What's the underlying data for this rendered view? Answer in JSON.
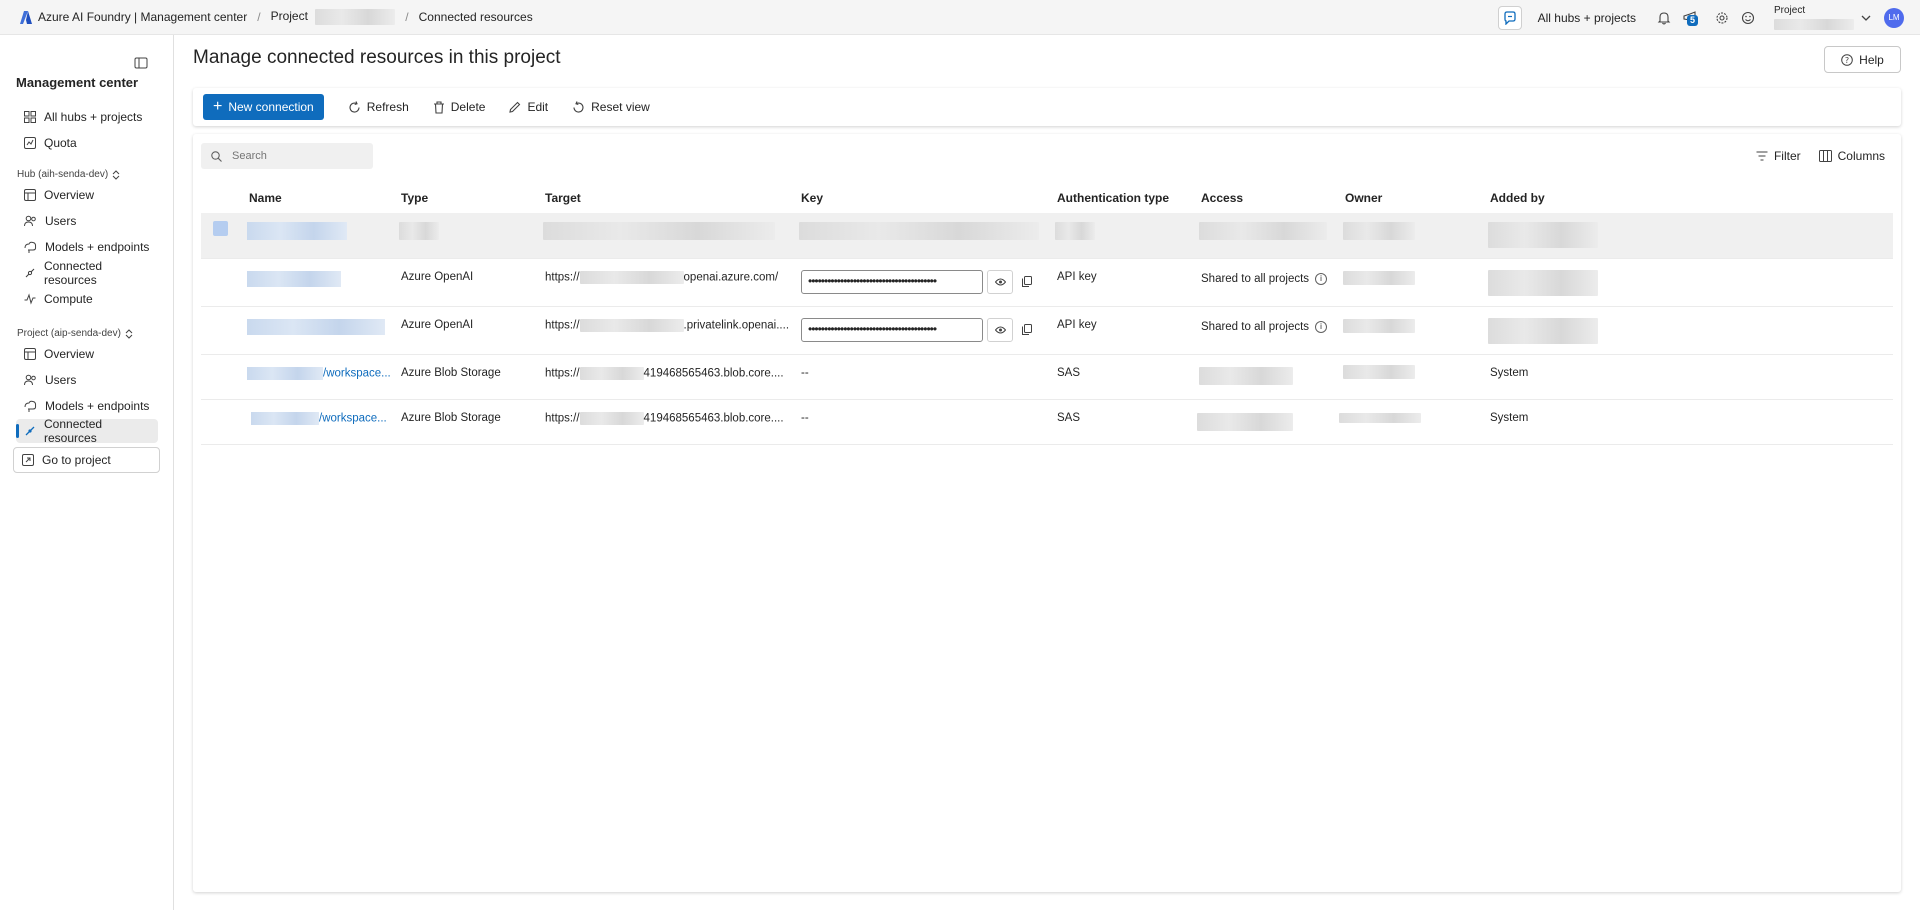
{
  "header": {
    "app_title": "Azure AI Foundry | Management center",
    "breadcrumb_project": "Project",
    "breadcrumb_current": "Connected resources",
    "all_hubs_link": "All hubs + projects",
    "notification_count": "5",
    "project_label": "Project",
    "avatar_initials": "LM"
  },
  "sidebar": {
    "title": "Management center",
    "top_items": [
      {
        "label": "All hubs + projects",
        "icon": "grid-icon"
      },
      {
        "label": "Quota",
        "icon": "quota-icon"
      }
    ],
    "hub_group": "Hub (aih-senda-dev)",
    "hub_items": [
      {
        "label": "Overview",
        "icon": "overview-icon"
      },
      {
        "label": "Users",
        "icon": "users-icon"
      },
      {
        "label": "Models + endpoints",
        "icon": "models-icon"
      },
      {
        "label": "Connected resources",
        "icon": "link-icon"
      },
      {
        "label": "Compute",
        "icon": "compute-icon"
      }
    ],
    "project_group": "Project (aip-senda-dev)",
    "project_items": [
      {
        "label": "Overview",
        "icon": "overview-icon"
      },
      {
        "label": "Users",
        "icon": "users-icon"
      },
      {
        "label": "Models + endpoints",
        "icon": "models-icon"
      },
      {
        "label": "Connected resources",
        "icon": "link-icon",
        "active": true
      }
    ],
    "go_to_project": "Go to project"
  },
  "main": {
    "title": "Manage connected resources in this project",
    "help": "Help",
    "toolbar": {
      "new_connection": "New connection",
      "refresh": "Refresh",
      "delete": "Delete",
      "edit": "Edit",
      "reset_view": "Reset view"
    },
    "search_placeholder": "Search",
    "filter": "Filter",
    "columns": "Columns",
    "headers": [
      "Name",
      "Type",
      "Target",
      "Key",
      "Authentication type",
      "Access",
      "Owner",
      "Added by"
    ],
    "rows": [
      {
        "name": "",
        "type": "Azure OpenAI",
        "target_prefix": "https://",
        "target_suffix": "openai.azure.com/",
        "key": "••••••••••••••••••••••••••••••••••••••••",
        "auth": "API key",
        "access": "Shared to all projects",
        "added_by": ""
      },
      {
        "name": "",
        "type": "Azure OpenAI",
        "target_prefix": "https://",
        "target_suffix": ".privatelink.openai....",
        "key": "••••••••••••••••••••••••••••••••••••••••",
        "auth": "API key",
        "access": "Shared to all projects",
        "added_by": ""
      },
      {
        "name_suffix": "/workspace...",
        "type": "Azure Blob Storage",
        "target_prefix": "https://",
        "target_suffix": "419468565463.blob.core....",
        "key": "--",
        "auth": "SAS",
        "access": "",
        "added_by": "System"
      },
      {
        "name_suffix": "/workspace...",
        "type": "Azure Blob Storage",
        "target_prefix": "https://",
        "target_suffix": "419468565463.blob.core....",
        "key": "--",
        "auth": "SAS",
        "access": "",
        "added_by": "System"
      }
    ]
  },
  "colors": {
    "accent": "#0f6cbd",
    "topbar_bg": "#f5f5f5",
    "avatar_bg": "#4f6bed"
  }
}
